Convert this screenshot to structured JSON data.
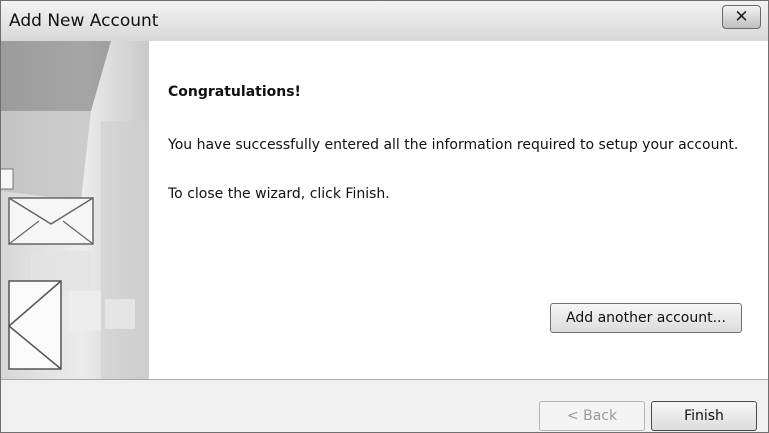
{
  "window": {
    "title": "Add New Account",
    "close_label": "✕"
  },
  "content": {
    "heading": "Congratulations!",
    "message1": "You have successfully entered all the information required to setup your account.",
    "message2": "To close the wizard, click Finish.",
    "add_another_label": "Add another account..."
  },
  "footer": {
    "back_label": "< Back",
    "finish_label": "Finish"
  },
  "icons": {
    "banner": "mail-envelope-graphic",
    "close": "close-icon"
  }
}
